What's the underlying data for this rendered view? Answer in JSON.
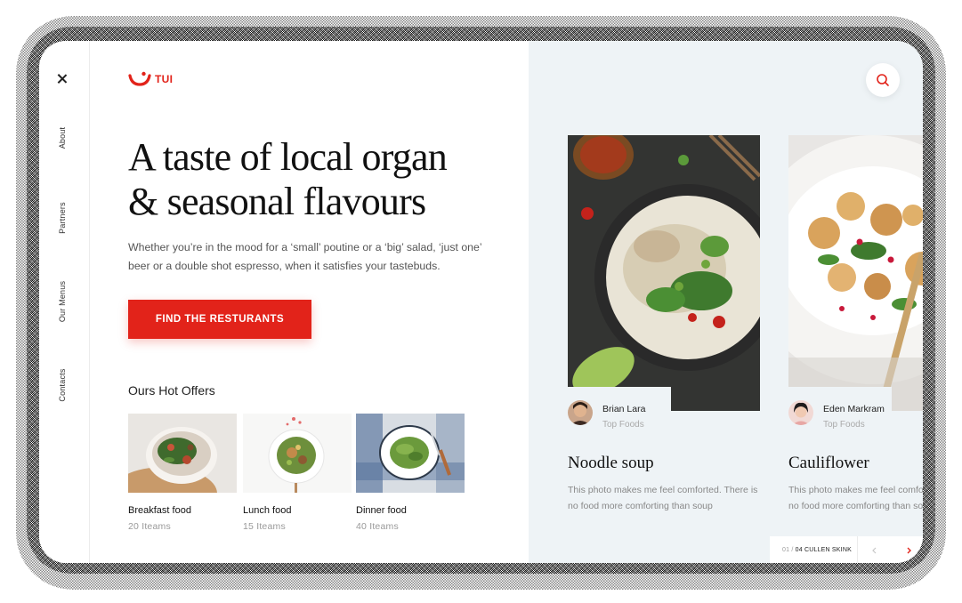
{
  "sidebar": {
    "close_icon": "close-icon",
    "links": [
      "About",
      "Partners",
      "Our Menus",
      "Contacts"
    ]
  },
  "brand": {
    "logo_text": "TUI",
    "color": "#e2231a"
  },
  "hero": {
    "title_line1": "A taste of local organ",
    "title_line2": "& seasonal flavours",
    "intro": "Whether you’re in the mood for a ‘small’ poutine or a ‘big’ salad, ‘just one’ beer or a double shot espresso, when it satisfies your tastebuds.",
    "cta_label": "FIND THE RESTURANTS"
  },
  "offers": {
    "title": "Ours Hot Offers",
    "items": [
      {
        "name": "Breakfast food",
        "count": "20 Iteams"
      },
      {
        "name": "Lunch food",
        "count": "15 Iteams"
      },
      {
        "name": "Dinner food",
        "count": "40 Iteams"
      }
    ]
  },
  "cards": [
    {
      "author": "Brian Lara",
      "role": "Top Foods",
      "title": "Noodle soup",
      "desc": "This photo makes me feel comforted. There is no food more comforting than soup"
    },
    {
      "author": "Eden Markram",
      "role": "Top Foods",
      "title": "Cauliflower",
      "desc": "This photo makes me feel comforted. There is no food more comforting than soup"
    }
  ],
  "pager": {
    "current": "01 /",
    "label": "04 CULLEN SKINK"
  },
  "icons": {
    "search": "search-icon",
    "prev": "chevron-left-icon",
    "next": "chevron-right-icon"
  }
}
